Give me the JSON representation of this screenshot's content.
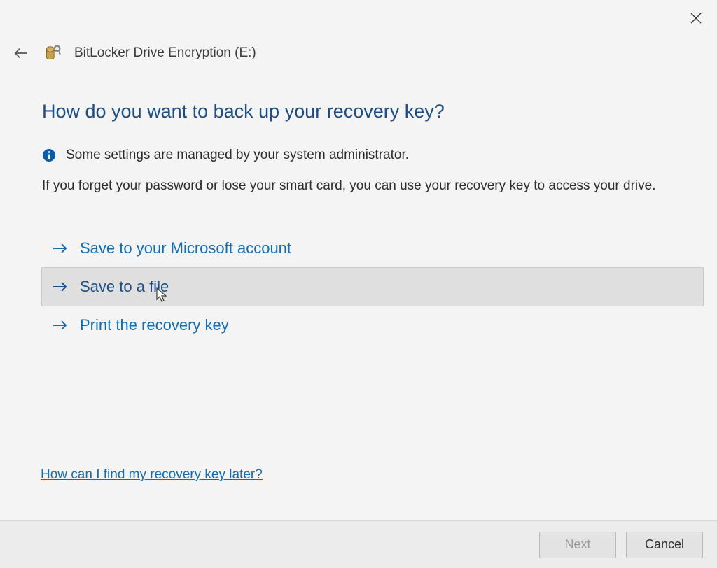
{
  "header": {
    "title": "BitLocker Drive Encryption (E:)"
  },
  "main": {
    "heading": "How do you want to back up your recovery key?",
    "info_text": "Some settings are managed by your system administrator.",
    "description": "If you forget your password or lose your smart card, you can use your recovery key to access your drive.",
    "options": [
      {
        "label": "Save to your Microsoft account",
        "hovered": false
      },
      {
        "label": "Save to a file",
        "hovered": true
      },
      {
        "label": "Print the recovery key",
        "hovered": false
      }
    ],
    "help_link": "How can I find my recovery key later?"
  },
  "footer": {
    "next_label": "Next",
    "cancel_label": "Cancel",
    "next_enabled": false
  },
  "colors": {
    "accent_blue": "#0f6db8",
    "heading_blue": "#1b4e87",
    "hover_bg": "#dfdfdf"
  }
}
